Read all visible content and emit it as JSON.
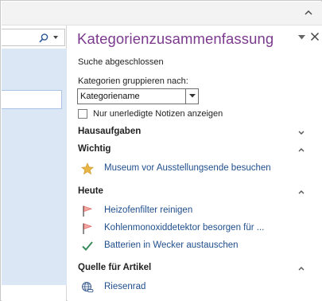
{
  "pane": {
    "title": "Kategorienzusammenfassung",
    "status": "Suche abgeschlossen",
    "group_by_label": "Kategorien gruppieren nach:",
    "group_by_value": "Kategoriename",
    "unread_only_label": "Nur unerledigte Notizen anzeigen",
    "unread_only_checked": false
  },
  "sections": [
    {
      "title": "Hausaufgaben",
      "expanded": false,
      "items": []
    },
    {
      "title": "Wichtig",
      "expanded": true,
      "items": [
        {
          "label": "Museum vor Ausstellungsende besuchen",
          "icon": "star-icon"
        }
      ]
    },
    {
      "title": "Heute",
      "expanded": true,
      "items": [
        {
          "label": "Heizofenfilter reinigen",
          "icon": "flag-icon"
        },
        {
          "label": "Kohlenmonoxiddetektor besorgen für ...",
          "icon": "flag-icon"
        },
        {
          "label": "Batterien in Wecker austauschen",
          "icon": "checkmark-icon"
        }
      ]
    },
    {
      "title": "Quelle für Artikel",
      "expanded": true,
      "items": [
        {
          "label": "Riesenrad",
          "icon": "globe-link-icon"
        }
      ]
    }
  ],
  "colors": {
    "title": "#7b3a8e",
    "link": "#1f4e8c",
    "star": "#e8b444",
    "flag": "#d9534f",
    "check": "#3a8c5c",
    "left_selection": "#dce7f6"
  }
}
